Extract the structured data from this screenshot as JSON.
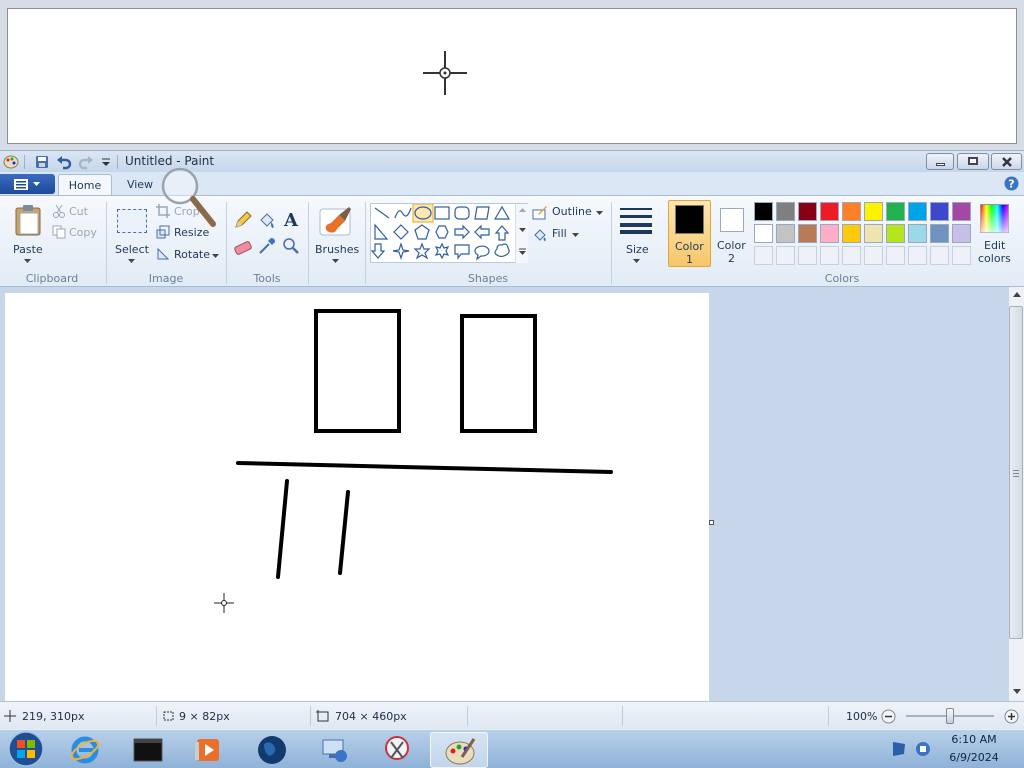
{
  "window": {
    "title": "Untitled - Paint"
  },
  "tabs": {
    "home": "Home",
    "view": "View"
  },
  "ribbon": {
    "clipboard": {
      "label": "Clipboard",
      "paste": "Paste",
      "cut": "Cut",
      "copy": "Copy"
    },
    "image": {
      "label": "Image",
      "select": "Select",
      "crop": "Crop",
      "resize": "Resize",
      "rotate": "Rotate"
    },
    "tools": {
      "label": "Tools"
    },
    "brushes": {
      "label": "Brushes"
    },
    "shapes": {
      "label": "Shapes",
      "outline": "Outline",
      "fill": "Fill",
      "selected_shape": "oval"
    },
    "size": {
      "label": "Size"
    },
    "color1": {
      "label_line1": "Color",
      "label_line2": "1",
      "value": "#000000"
    },
    "color2": {
      "label_line1": "Color",
      "label_line2": "2",
      "value": "#ffffff"
    },
    "colors": {
      "label": "Colors",
      "edit_line1": "Edit",
      "edit_line2": "colors",
      "palette_row1": [
        "#000000",
        "#7f7f7f",
        "#880015",
        "#ed1c24",
        "#ff7f27",
        "#fff200",
        "#22b14c",
        "#00a2e8",
        "#3f48cc",
        "#a349a4"
      ],
      "palette_row2": [
        "#ffffff",
        "#c3c3c3",
        "#b97a57",
        "#ffaec9",
        "#ffc90e",
        "#efe4b0",
        "#b5e61d",
        "#99d9ea",
        "#7092be",
        "#c8bfe7"
      ]
    }
  },
  "status": {
    "cursor_pos": "219, 310px",
    "selection_size": "9 × 82px",
    "image_size": "704 × 460px",
    "zoom": "100%",
    "zoom_level": 0.5
  },
  "taskbar": {
    "time": "6:10 AM",
    "date": "6/9/2024",
    "apps": [
      "start-orb",
      "internet-explorer",
      "command-prompt",
      "media-player",
      "globe",
      "network-tool",
      "snipping-tool",
      "paint"
    ]
  }
}
